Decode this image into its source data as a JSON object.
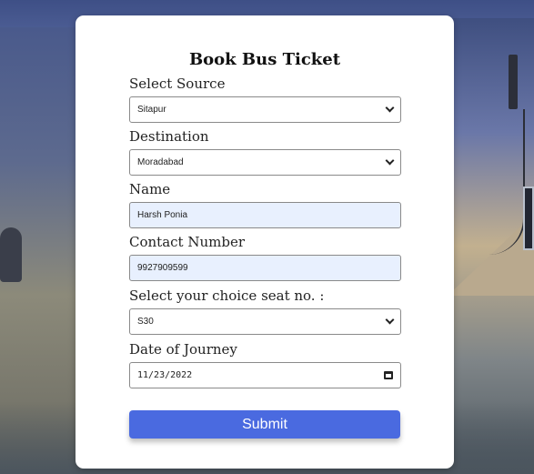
{
  "form": {
    "title": "Book Bus Ticket",
    "source": {
      "label": "Select Source",
      "value": "Sitapur"
    },
    "destination": {
      "label": "Destination",
      "value": "Moradabad"
    },
    "name": {
      "label": "Name",
      "value": "Harsh Ponia"
    },
    "contact": {
      "label": "Contact Number",
      "value": "9927909599"
    },
    "seat": {
      "label": "Select your choice seat no. :",
      "value": "S30"
    },
    "date": {
      "label": "Date of Journey",
      "value": "11/23/2022"
    },
    "submit_label": "Submit"
  }
}
